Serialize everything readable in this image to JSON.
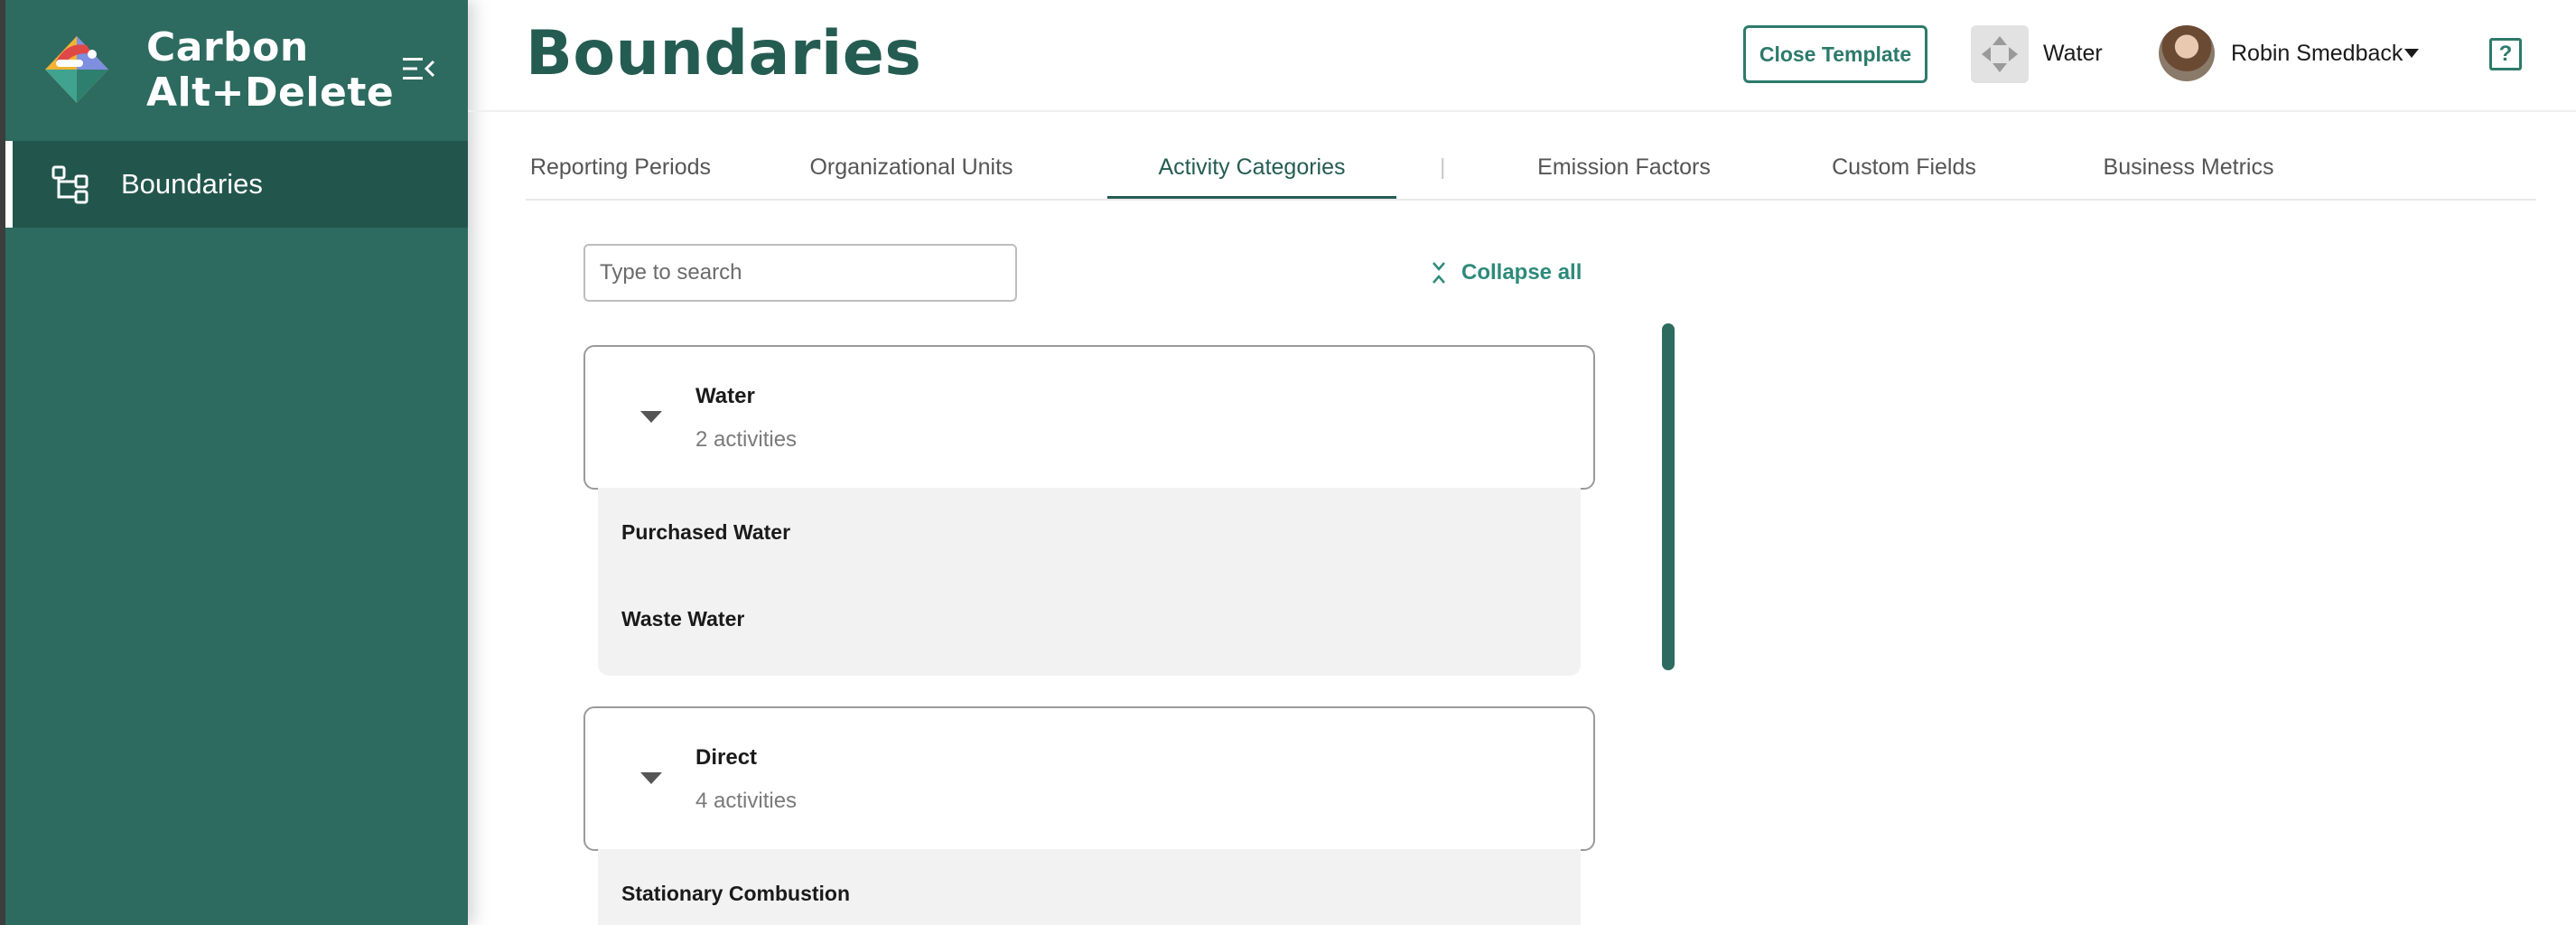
{
  "app": {
    "brand_name": "Carbon Alt+Delete"
  },
  "sidebar": {
    "collapse_icon": "menu-collapse-icon",
    "items": [
      {
        "label": "Boundaries",
        "icon": "hierarchy-icon",
        "active": true
      }
    ]
  },
  "header": {
    "title": "Boundaries",
    "close_template_label": "Close Template",
    "template_icon": "template-arrows-icon",
    "template_name": "Water",
    "user_name": "Robin Smedback",
    "help_label": "?"
  },
  "tabs": [
    {
      "label": "Reporting Periods",
      "active": false
    },
    {
      "label": "Organizational Units",
      "active": false
    },
    {
      "label": "Activity Categories",
      "active": true
    },
    {
      "label": "Emission Factors",
      "active": false
    },
    {
      "label": "Custom Fields",
      "active": false
    },
    {
      "label": "Business Metrics",
      "active": false
    }
  ],
  "tab_separator": "|",
  "search": {
    "placeholder": "Type to search",
    "value": ""
  },
  "collapse_all_label": "Collapse all",
  "groups": [
    {
      "title": "Water",
      "count_label": "2 activities",
      "expanded": true,
      "items": [
        "Purchased Water",
        "Waste Water"
      ]
    },
    {
      "title": "Direct",
      "count_label": "4 activities",
      "expanded": true,
      "items": [
        "Stationary Combustion"
      ]
    }
  ],
  "colors": {
    "sidebar_bg": "#2d6a5f",
    "brand_green": "#255c52",
    "accent": "#2d7a6c"
  }
}
